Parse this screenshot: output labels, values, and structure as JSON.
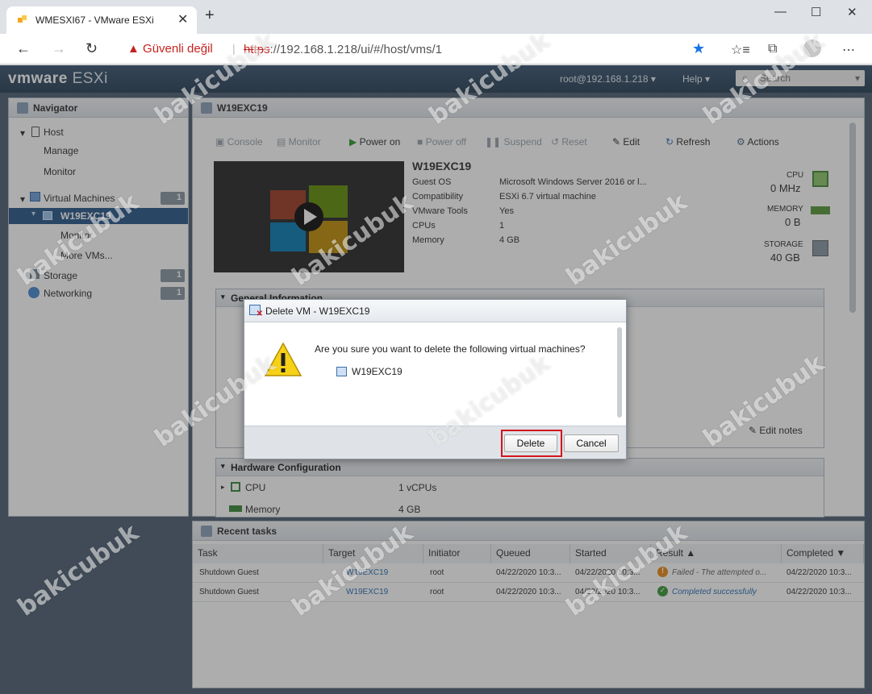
{
  "browser": {
    "tab_title": "WMESXI67 - VMware ESXi",
    "url_warning": "Güvenli değil",
    "url_scheme": "https",
    "url_rest": "://192.168.1.218/ui/#/host/vms/1"
  },
  "esxi": {
    "logo_vm": "vmware",
    "logo_esxi": "ESXi",
    "user": "root@192.168.1.218 ▾",
    "help": "Help ▾",
    "search_placeholder": "Search"
  },
  "navigator": {
    "title": "Navigator",
    "host": "Host",
    "manage": "Manage",
    "monitor": "Monitor",
    "vms": "Virtual Machines",
    "vms_count": "1",
    "vm_selected": "W19EXC19",
    "vm_monitor": "Monitor",
    "more_vms": "More VMs...",
    "storage": "Storage",
    "storage_count": "1",
    "networking": "Networking",
    "networking_count": "1"
  },
  "vm": {
    "panel_title": "W19EXC19",
    "toolbar": {
      "console": "Console",
      "monitor": "Monitor",
      "power_on": "Power on",
      "power_off": "Power off",
      "suspend": "Suspend",
      "reset": "Reset",
      "edit": "Edit",
      "refresh": "Refresh",
      "actions": "Actions"
    },
    "name": "W19EXC19",
    "details": [
      {
        "k": "Guest OS",
        "v": "Microsoft Windows Server 2016 or l..."
      },
      {
        "k": "Compatibility",
        "v": "ESXi 6.7 virtual machine"
      },
      {
        "k": "VMware Tools",
        "v": "Yes"
      },
      {
        "k": "CPUs",
        "v": "1"
      },
      {
        "k": "Memory",
        "v": "4 GB"
      }
    ],
    "cpu_label": "CPU",
    "cpu_value": "0 MHz",
    "mem_label": "MEMORY",
    "mem_value": "0 B",
    "storage_label": "STORAGE",
    "storage_value": "40 GB",
    "general_info": "General Information",
    "edit_notes": "Edit notes",
    "hw_title": "Hardware Configuration",
    "hw": [
      {
        "k": "CPU",
        "v": "1 vCPUs"
      },
      {
        "k": "Memory",
        "v": "4 GB"
      }
    ]
  },
  "tasks": {
    "title": "Recent tasks",
    "columns": [
      "Task",
      "Target",
      "Initiator",
      "Queued",
      "Started",
      "Result ▲",
      "Completed ▼"
    ],
    "rows": [
      [
        "Shutdown Guest",
        "W19EXC19",
        "root",
        "04/22/2020 10:3...",
        "04/22/2020 10:3...",
        "Failed - The attempted o...",
        "04/22/2020 10:3..."
      ],
      [
        "Shutdown Guest",
        "W19EXC19",
        "root",
        "04/22/2020 10:3...",
        "04/22/2020 10:3...",
        "Completed successfully",
        "04/22/2020 10:3..."
      ]
    ]
  },
  "dialog": {
    "title": "Delete VM - W19EXC19",
    "question": "Are you sure you want to delete the following virtual machines?",
    "vm": "W19EXC19",
    "delete": "Delete",
    "cancel": "Cancel"
  },
  "watermark": "bakicubuk"
}
